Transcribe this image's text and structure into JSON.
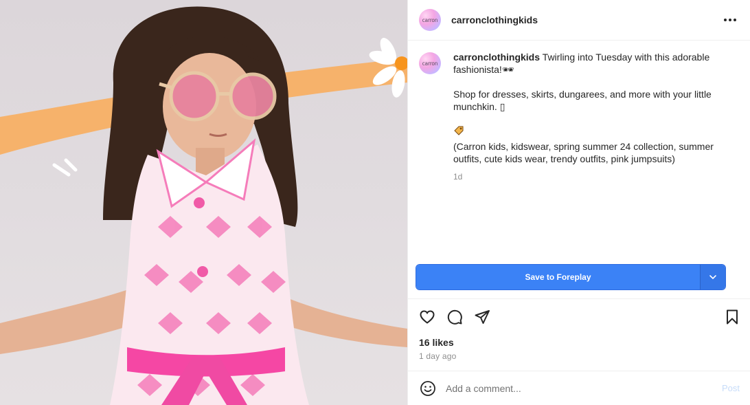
{
  "post": {
    "username": "carronclothingkids",
    "avatar_text": "carron",
    "caption_line1": " Twirling into Tuesday with this adorable fashionista!",
    "caption_line1_emoji": "🕶",
    "caption_line2": "Shop for dresses, skirts, dungarees, and more with your little munchkin. ▯",
    "caption_line3": "(Carron kids, kidswear, spring summer 24 collection, summer outfits, cute kids wear, trendy outfits, pink jumpsuits)",
    "caption_time": "1d",
    "likes": "16 likes",
    "posted_ago": "1 day ago"
  },
  "save": {
    "label": "Save to Foreplay"
  },
  "comment": {
    "placeholder": "Add a comment...",
    "post_label": "Post"
  },
  "icons": {
    "more": "more-horizontal-icon",
    "like": "heart-icon",
    "comment": "comment-bubble-icon",
    "share": "paper-plane-icon",
    "bookmark": "bookmark-icon",
    "emoji": "smiley-icon",
    "dropdown": "chevron-down-icon"
  },
  "colors": {
    "accent": "#3b82f6",
    "post_disabled": "#c7dcf9",
    "muted": "#8e8e8e"
  }
}
